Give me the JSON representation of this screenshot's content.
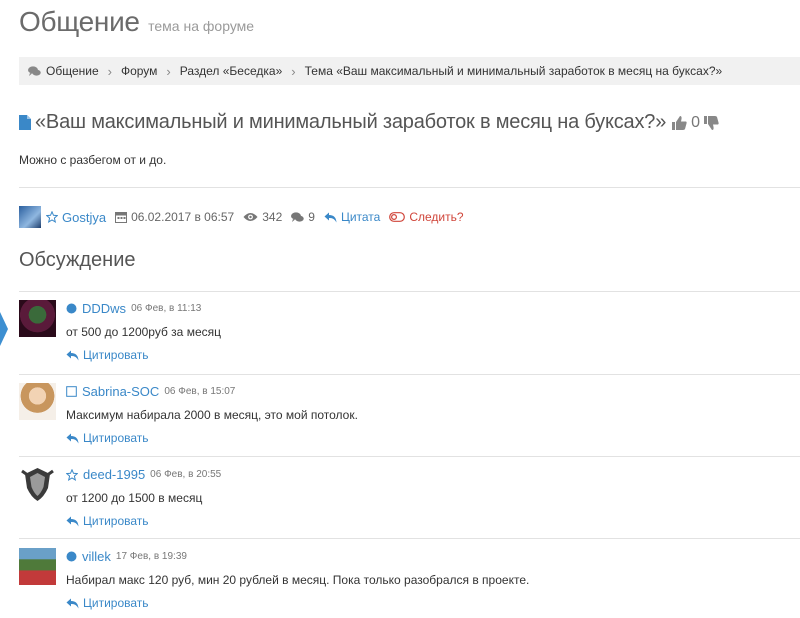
{
  "header": {
    "title": "Общение",
    "subtitle": "тема на форуме"
  },
  "breadcrumb": {
    "items": [
      {
        "label": "Общение",
        "icon": "comments-icon"
      },
      {
        "label": "Форум"
      },
      {
        "label": "Раздел «Беседка»"
      },
      {
        "label": "Тема «Ваш максимальный и минимальный заработок в месяц на буксах?»"
      }
    ]
  },
  "topic": {
    "icon": "document-icon",
    "title": "«Ваш максимальный и минимальный заработок в месяц на буксах?»",
    "likes": "0",
    "body": "Можно с разбегом от и до.",
    "author": "Gostjya",
    "date": "06.02.2017 в 06:57",
    "views": "342",
    "comments_count": "9",
    "quote_label": "Цитата",
    "follow_label": "Следить?"
  },
  "discussion": {
    "title": "Обсуждение",
    "quote_label": "Цитировать",
    "comments": [
      {
        "user": "DDDws",
        "date": "06 Фев, в 11:13",
        "text": "от 500 до 1200руб за месяц",
        "status": "online-dot"
      },
      {
        "user": "Sabrina-SOC",
        "date": "06 Фев, в 15:07",
        "text": "Максимум набирала 2000 в месяц, это мой потолок.",
        "status": "square-icon"
      },
      {
        "user": "deed-1995",
        "date": "06 Фев, в 20:55",
        "text": "от 1200 до 1500 в месяц",
        "status": "star-icon"
      },
      {
        "user": "villek",
        "date": "17 Фев, в 19:39",
        "text": "Набирал макс 120 руб, мин 20 рублей в месяц. Пока только разобрался в проекте.",
        "status": "online-dot"
      }
    ]
  },
  "colors": {
    "link": "#3a88c8",
    "muted": "#777777",
    "follow": "#d0453a",
    "marker": "#3d8fd1"
  }
}
